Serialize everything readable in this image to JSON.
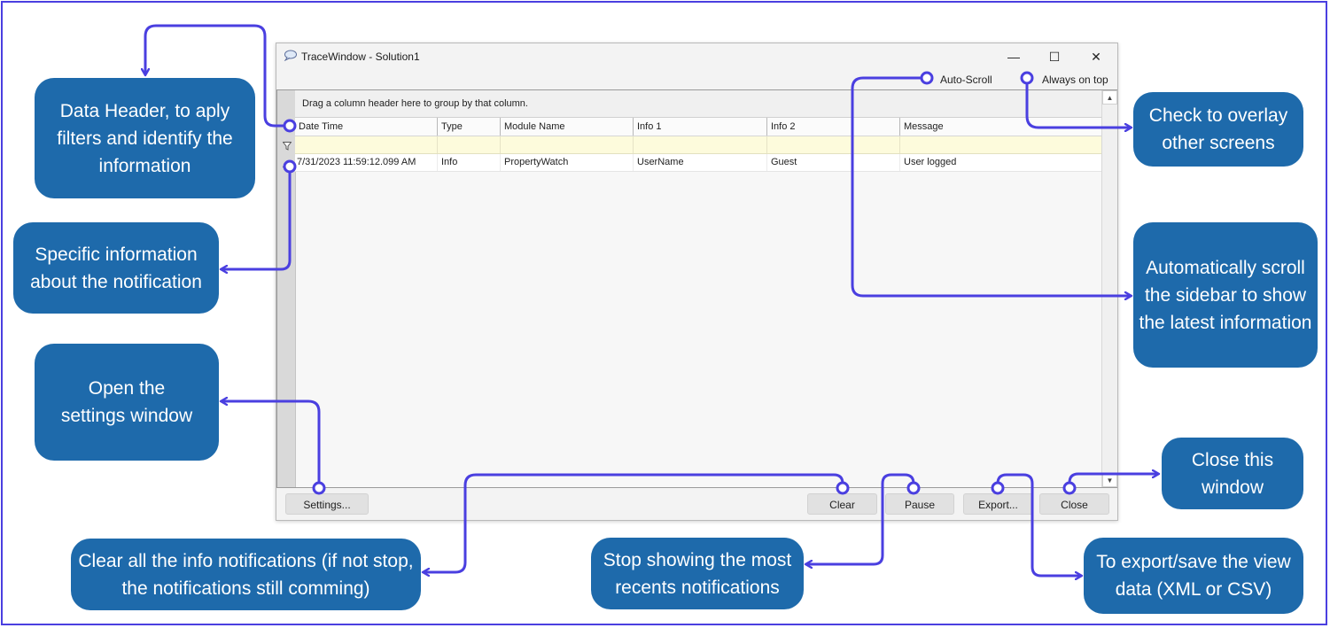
{
  "window": {
    "title": "TraceWindow - Solution1",
    "minimize_glyph": "—",
    "maximize_glyph": "☐",
    "close_glyph": "✕",
    "auto_scroll_label": "Auto-Scroll",
    "always_on_top_label": "Always on top",
    "group_panel_text": "Drag a column header here to group by that column.",
    "columns": [
      "Date Time",
      "Type",
      "Module Name",
      "Info 1",
      "Info 2",
      "Message"
    ],
    "rows": [
      [
        "7/31/2023 11:59:12.099 AM",
        "Info",
        "PropertyWatch",
        "UserName",
        "Guest",
        "User logged"
      ]
    ],
    "buttons": {
      "settings": "Settings...",
      "clear": "Clear",
      "pause": "Pause",
      "export": "Export...",
      "close": "Close"
    }
  },
  "callouts": {
    "data_header": "Data Header, to aply filters and identify the information",
    "specific_info": "Specific information about the notification",
    "settings": "Open the settings window",
    "clear": "Clear all the info notifications (if not stop, the notifications still comming)",
    "pause": "Stop showing the most recents notifications",
    "export": "To export/save the view data (XML or CSV)",
    "close": "Close this window",
    "auto_scroll": "Automatically scroll the sidebar to show the latest information",
    "always_on_top": "Check to overlay other screens"
  },
  "colors": {
    "accent_line": "#4a3fe0",
    "callout_bg": "#1e6aab",
    "filter_row_bg": "#fdfbdc"
  }
}
